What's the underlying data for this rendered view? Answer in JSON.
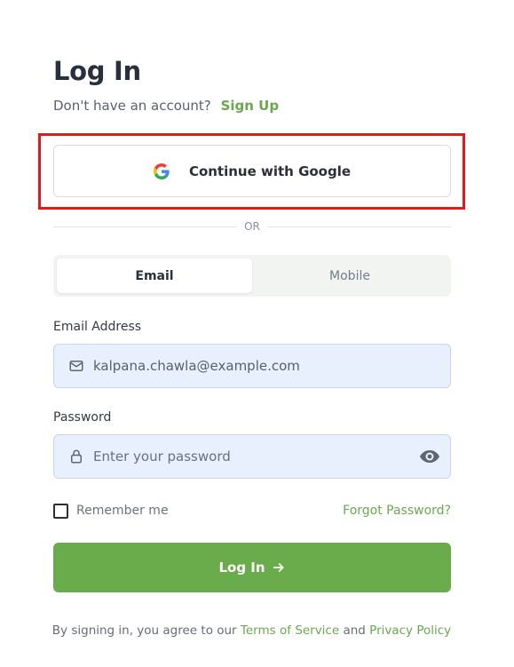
{
  "page": {
    "title": "Log In",
    "signup_prompt": "Don't have an account?",
    "signup_link": "Sign Up"
  },
  "google": {
    "label": "Continue with Google",
    "icon": "google-icon"
  },
  "divider": {
    "label": "OR"
  },
  "tabs": [
    {
      "label": "Email",
      "active": true
    },
    {
      "label": "Mobile",
      "active": false
    }
  ],
  "email": {
    "label": "Email Address",
    "value": "kalpana.chawla@example.com",
    "icon": "mail-icon"
  },
  "password": {
    "label": "Password",
    "placeholder": "Enter your password",
    "icon": "lock-icon",
    "toggle_icon": "eye-icon"
  },
  "remember": {
    "label": "Remember me",
    "checked": false
  },
  "forgot": {
    "label": "Forgot Password?"
  },
  "login_button": {
    "label": "Log In",
    "icon": "arrow-right-icon"
  },
  "terms": {
    "prefix": "By signing in, you agree to our",
    "terms_link": "Terms of Service",
    "conjunction": "and",
    "privacy_link": "Privacy Policy"
  },
  "colors": {
    "accent": "#6aab4b",
    "highlight": "#e01b1b",
    "input_bg": "#e8effd"
  }
}
